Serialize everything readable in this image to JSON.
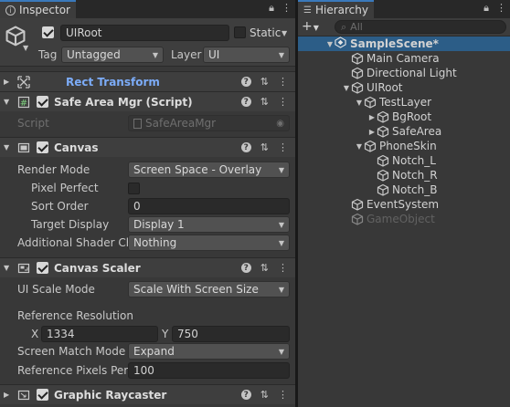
{
  "inspector": {
    "tab_label": "Inspector",
    "object": {
      "name": "UIRoot",
      "active": true,
      "static_label": "Static",
      "tag_label": "Tag",
      "tag_value": "Untagged",
      "layer_label": "Layer",
      "layer_value": "UI"
    },
    "components": [
      {
        "title": "Rect Transform",
        "icon": "rect-transform-icon"
      },
      {
        "title": "Safe Area Mgr (Script)",
        "icon": "script-icon",
        "script_label": "Script",
        "script_value": "SafeAreaMgr"
      },
      {
        "title": "Canvas",
        "icon": "canvas-icon"
      },
      {
        "title": "Canvas Scaler",
        "icon": "canvas-scaler-icon"
      },
      {
        "title": "Graphic Raycaster",
        "icon": "graphic-raycaster-icon"
      }
    ],
    "canvas": {
      "render_mode_label": "Render Mode",
      "render_mode_value": "Screen Space - Overlay",
      "pixel_perfect_label": "Pixel Perfect",
      "sort_order_label": "Sort Order",
      "sort_order_value": "0",
      "target_display_label": "Target Display",
      "target_display_value": "Display 1",
      "shader_label": "Additional Shader Ch",
      "shader_value": "Nothing"
    },
    "scaler": {
      "ui_scale_label": "UI Scale Mode",
      "ui_scale_value": "Scale With Screen Size",
      "ref_res_label": "Reference Resolution",
      "x_label": "X",
      "x_value": "1334",
      "y_label": "Y",
      "y_value": "750",
      "match_label": "Screen Match Mode",
      "match_value": "Expand",
      "ref_ppu_label": "Reference Pixels Per",
      "ref_ppu_value": "100"
    }
  },
  "hierarchy": {
    "tab_label": "Hierarchy",
    "add_label": "+",
    "search_placeholder": "All",
    "scene": "SampleScene*",
    "items": [
      {
        "name": "Main Camera"
      },
      {
        "name": "Directional Light"
      },
      {
        "name": "UIRoot"
      },
      {
        "name": "TestLayer"
      },
      {
        "name": "BgRoot"
      },
      {
        "name": "SafeArea"
      },
      {
        "name": "PhoneSkin"
      },
      {
        "name": "Notch_L"
      },
      {
        "name": "Notch_R"
      },
      {
        "name": "Notch_B"
      },
      {
        "name": "EventSystem"
      },
      {
        "name": "GameObject"
      }
    ]
  },
  "colors": {
    "panel_bg": "#383838",
    "header_bg": "#3e3e3e",
    "selection": "#2c5d87",
    "link": "#7cacf8",
    "tab_accent": "#3a79bb"
  }
}
